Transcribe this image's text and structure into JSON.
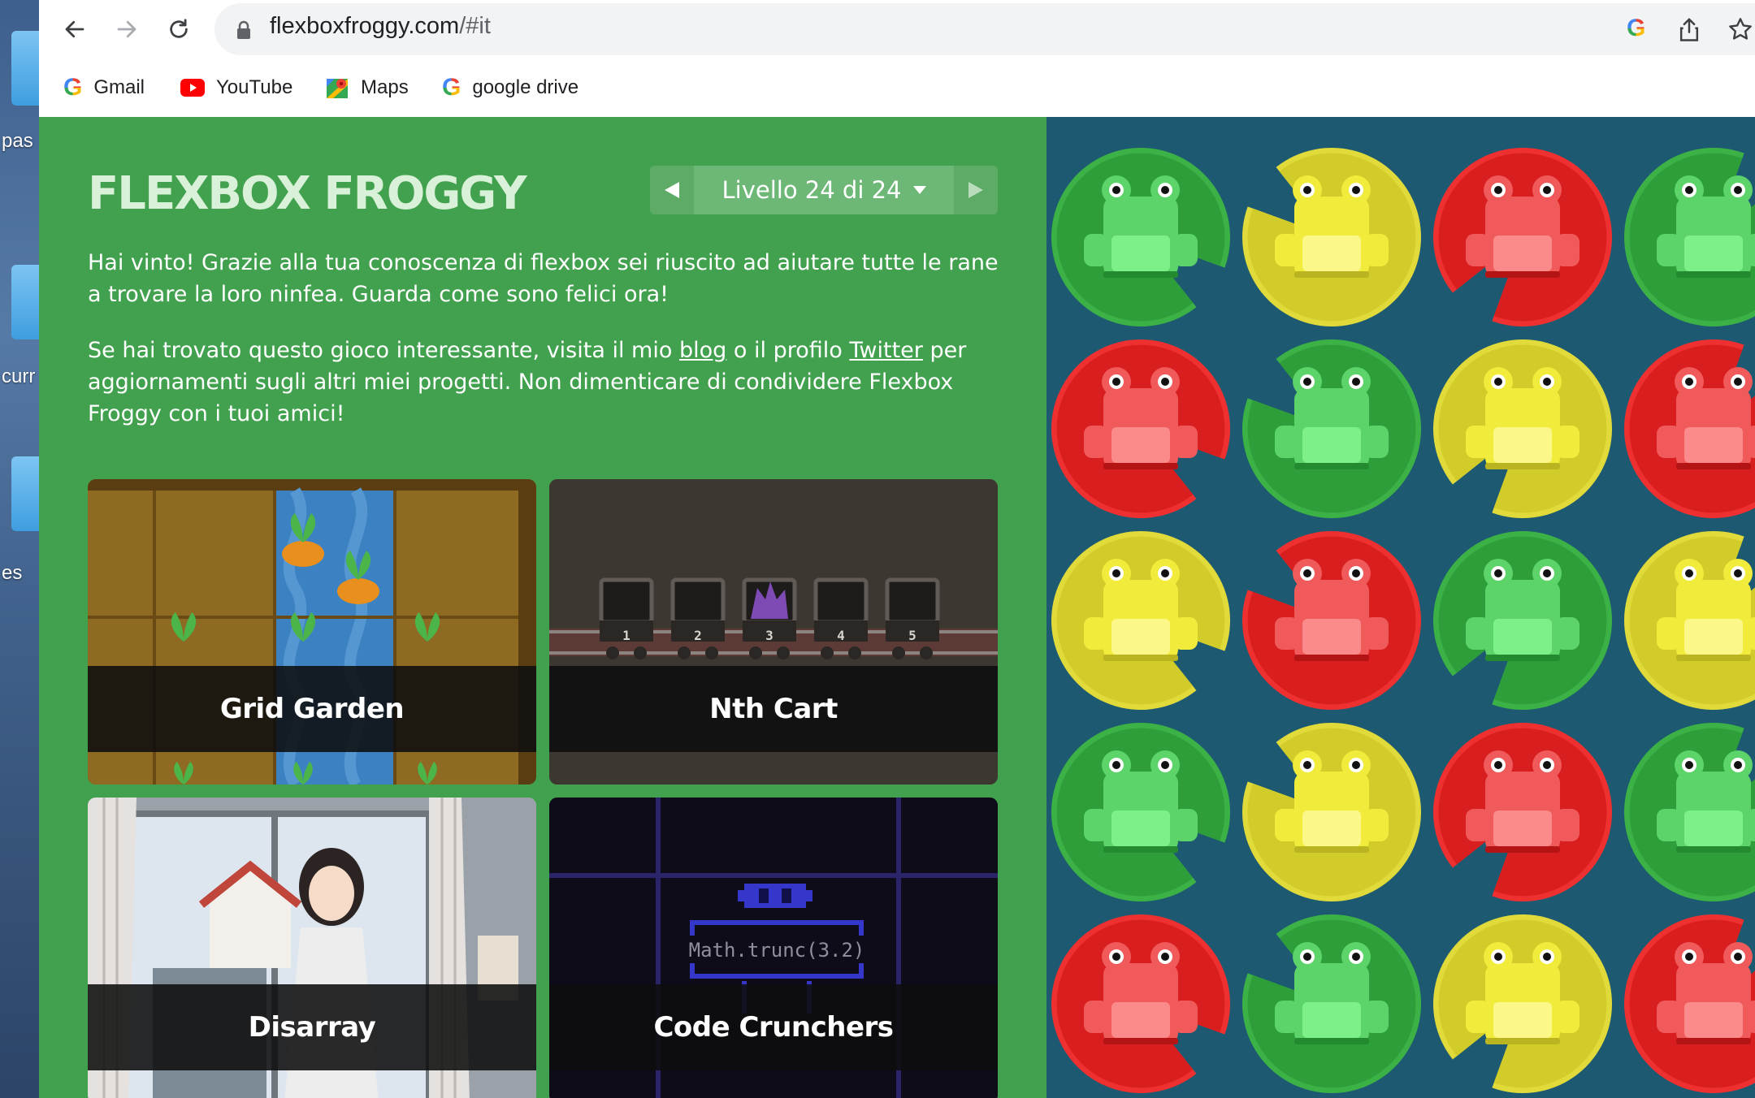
{
  "desktop": {
    "labels": [
      "pas",
      "curr",
      "es"
    ]
  },
  "browser": {
    "url_domain": "flexboxfroggy.com",
    "url_path": "/#it",
    "bookmarks": [
      {
        "label": "Gmail",
        "icon": "google-g-icon"
      },
      {
        "label": "YouTube",
        "icon": "youtube-icon"
      },
      {
        "label": "Maps",
        "icon": "maps-icon"
      },
      {
        "label": "google drive",
        "icon": "google-g-icon"
      }
    ]
  },
  "game": {
    "title": "FLEXBOX FROGGY",
    "level_label": "Livello 24 di 24",
    "win_message": "Hai vinto! Grazie alla tua conoscenza di flexbox sei riuscito ad aiutare tutte le rane a trovare la loro ninfea. Guarda come sono felici ora!",
    "share_intro": "Se hai trovato questo gioco interessante, visita il mio",
    "blog_link": "blog",
    "share_mid": "o il profilo",
    "twitter_link": "Twitter",
    "share_end": "per aggiornamenti sugli altri miei progetti. Non dimenticare di condividere Flexbox Froggy con i tuoi amici!",
    "cards": [
      {
        "label": "Grid Garden"
      },
      {
        "label": "Nth Cart",
        "cart_numbers": [
          "1",
          "2",
          "3",
          "4",
          "5"
        ]
      },
      {
        "label": "Disarray"
      },
      {
        "label": "Code Crunchers",
        "code_text": "Math.trunc(3.2)"
      }
    ]
  },
  "pond": {
    "colors": {
      "green": "#2e9e3a",
      "yellow": "#d2cc2a",
      "red": "#d81e1e",
      "water": "#1d5a72"
    },
    "rows": [
      [
        "green",
        "yellow",
        "red",
        "green"
      ],
      [
        "red",
        "green",
        "yellow",
        "red"
      ],
      [
        "yellow",
        "red",
        "green",
        "yellow"
      ],
      [
        "green",
        "yellow",
        "red",
        "green"
      ],
      [
        "red",
        "green",
        "yellow",
        "red"
      ]
    ]
  },
  "accent_colors": {
    "panel_green": "#42a14e",
    "title": "#d8f1d8"
  }
}
